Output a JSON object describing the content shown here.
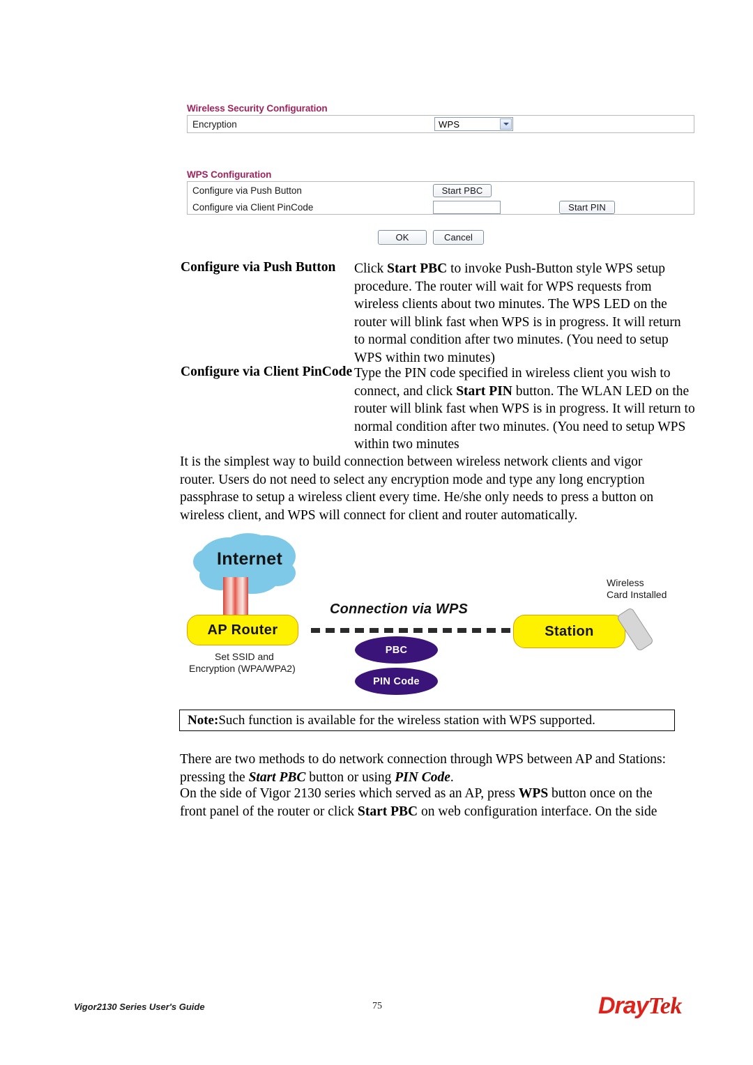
{
  "wireless_security_panel": {
    "section_title": "Wireless Security Configuration",
    "row_label": "Encryption",
    "select_value": "WPS",
    "select_options": [
      "WPS"
    ]
  },
  "wps_panel": {
    "section_title": "WPS Configuration",
    "rows": [
      {
        "label": "Configure via Push Button",
        "button": "Start PBC"
      },
      {
        "label": "Configure via Client PinCode",
        "input_value": "",
        "button": "Start PIN"
      }
    ]
  },
  "form_buttons": {
    "ok": "OK",
    "cancel": "Cancel"
  },
  "definitions": [
    {
      "term": "Configure via Push Button",
      "body": "Click Start PBC to invoke Push-Button style WPS setup procedure. The router will wait for WPS requests from wireless clients about two minutes. The WPS LED on the router will blink fast when WPS is in progress. It will return to normal condition after two minutes. (You need to setup WPS within two minutes)"
    },
    {
      "term": "Configure via Client PinCode",
      "body": "Type the PIN code specified in wireless client you wish to connect, and click Start PIN button. The WLAN LED on the router will blink fast when WPS is in progress. It will return to normal condition after two minutes. (You need to setup WPS within two minutes"
    }
  ],
  "paragraphs": {
    "intro": "It is the simplest way to build connection between wireless network clients and vigor router. Users do not need to select any encryption mode and type any long encryption passphrase to setup a wireless client every time. He/she only needs to press a button on wireless client, and WPS will connect for client and router automatically.",
    "note": "Note: Such function is available for the wireless station with WPS supported.",
    "note_label": "Note:",
    "note_text": " Such function is available for the wireless station with WPS supported.",
    "methods": "There are two methods to do network connection through WPS between AP and Stations: pressing the Start PBC button or using PIN Code.",
    "side": "On the side of Vigor 2130 series which served as an AP, press WPS button once on the front panel of the router or click Start PBC on web configuration interface. On the side"
  },
  "diagram": {
    "cloud_label": "Internet",
    "ap_router_label": "AP Router",
    "station_label": "Station",
    "connection_label": "Connection via WPS",
    "method_ovals": [
      "PBC",
      "PIN Code"
    ],
    "ap_caption_line1": "Set SSID and",
    "ap_caption_line2": "Encryption (WPA/WPA2)",
    "station_caption_line1": "Wireless",
    "station_caption_line2": "Card Installed",
    "colors": {
      "cloud": "#7ec8e8",
      "node": "#fff200",
      "node_border": "#d9a400",
      "oval": "#3a1478",
      "card": "#d6d6d6"
    }
  },
  "footer": {
    "guide": "Vigor2130 Series User's Guide",
    "page_number": "75",
    "brand_part1": "Dray",
    "brand_part2": "Tek",
    "brand_color": "#e0231a"
  }
}
